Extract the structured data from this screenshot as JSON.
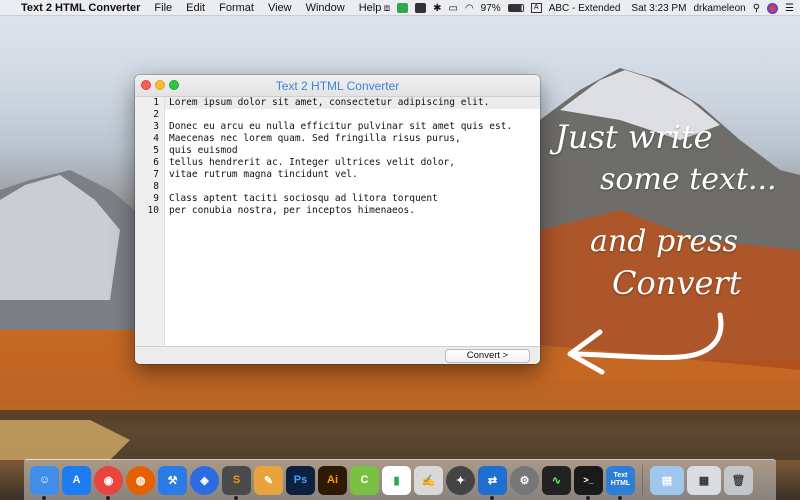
{
  "menubar": {
    "apple": "",
    "app_name": "Text 2 HTML Converter",
    "menus": [
      "File",
      "Edit",
      "Format",
      "View",
      "Window",
      "Help"
    ],
    "battery": "97%",
    "input_source": "ABC - Extended",
    "clock": "Sat 3:23 PM",
    "user": "drkameleon"
  },
  "window": {
    "title": "Text 2 HTML Converter",
    "lines": [
      {
        "n": "1",
        "text": "Lorem ipsum dolor sit amet, consectetur adipiscing elit."
      },
      {
        "n": "2",
        "text": ""
      },
      {
        "n": "3",
        "text": "Donec eu arcu eu nulla efficitur pulvinar sit amet quis est."
      },
      {
        "n": "4",
        "text": "Maecenas nec lorem quam. Sed fringilla risus purus,"
      },
      {
        "n": "5",
        "text": "quis euismod"
      },
      {
        "n": "6",
        "text": "tellus hendrerit ac. Integer ultrices velit dolor,"
      },
      {
        "n": "7",
        "text": "vitae rutrum magna tincidunt vel."
      },
      {
        "n": "8",
        "text": ""
      },
      {
        "n": "9",
        "text": "Class aptent taciti sociosqu ad litora torquent"
      },
      {
        "n": "10",
        "text": "per conubia nostra, per inceptos himenaeos."
      }
    ],
    "convert_label": "Convert >"
  },
  "handwriting": {
    "line1": "Just write",
    "line2": "some text...",
    "line3": "and press",
    "line4": "Convert"
  },
  "dock": {
    "apps": [
      {
        "name": "finder-icon",
        "color": "#3f8fe8",
        "glyph": "☺"
      },
      {
        "name": "app-store-icon",
        "color": "#1d7cf2",
        "glyph": "A"
      },
      {
        "name": "chrome-icon",
        "color": "#e8453c",
        "glyph": "◉"
      },
      {
        "name": "firefox-icon",
        "color": "#e66000",
        "glyph": "◍"
      },
      {
        "name": "xcode-icon",
        "color": "#2a7be3",
        "glyph": "⚒"
      },
      {
        "name": "maps-icon",
        "color": "#2b6de0",
        "glyph": "◈"
      },
      {
        "name": "sublime-icon",
        "color": "#4a4a4a",
        "glyph": "S"
      },
      {
        "name": "sketch-icon",
        "color": "#e8a33a",
        "glyph": "✎"
      },
      {
        "name": "photoshop-icon",
        "color": "#0e1f3f",
        "glyph": "Ps"
      },
      {
        "name": "illustrator-icon",
        "color": "#2e1a04",
        "glyph": "Ai"
      },
      {
        "name": "color-icon",
        "color": "#7ac143",
        "glyph": "C"
      },
      {
        "name": "numbers-icon",
        "color": "#2fa84f",
        "glyph": "▮"
      },
      {
        "name": "textedit-icon",
        "color": "#d9d9d9",
        "glyph": "✍"
      },
      {
        "name": "compass-icon",
        "color": "#444444",
        "glyph": "✦"
      },
      {
        "name": "teamviewer-icon",
        "color": "#1f6fd1",
        "glyph": "⇄"
      },
      {
        "name": "system-prefs-icon",
        "color": "#777777",
        "glyph": "⚙"
      },
      {
        "name": "activity-monitor-icon",
        "color": "#222222",
        "glyph": "∿"
      },
      {
        "name": "terminal-icon",
        "color": "#1a1a1a",
        "glyph": ">_"
      },
      {
        "name": "text2html-icon",
        "color": "#2d7ed6",
        "glyph": "Text HTML"
      }
    ],
    "trash_label": ""
  }
}
